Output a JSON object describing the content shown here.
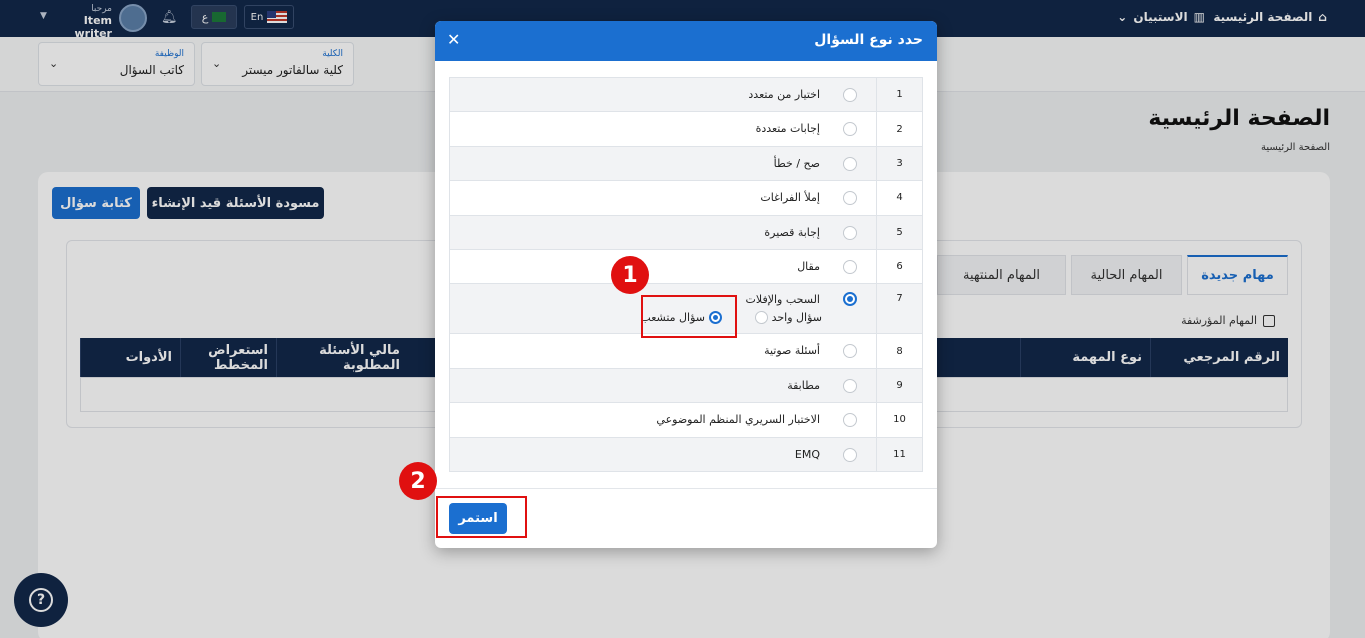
{
  "topbar": {
    "brand": "الصفحة الرئيسية",
    "school": "الاستبيان",
    "lang_en": "En",
    "lang_ar": "ع",
    "greeting": "مرحبا",
    "username": "Item writer"
  },
  "subbar": {
    "college_caption": "الكلية",
    "college_value": "كلية سالفاتور ميستر",
    "job_caption": "الوظيفة",
    "job_value": "كاتب السؤال"
  },
  "page": {
    "title": "الصفحة الرئيسية",
    "breadcrumb": "الصفحة الرئيسية",
    "write_button": "كتابة سؤال",
    "draft_button": "مسودة الأسئلة قيد الإنشاء",
    "tabs": [
      "مهام جديدة",
      "المهام الحالية",
      "المهام المنتهية"
    ],
    "archived_label": "المهام المؤرشفة",
    "columns": [
      "الرقم المرجعي",
      "نوع المهمة",
      "مالي الأسئلة المطلوبة",
      "استعراض المخطط",
      "الأدوات"
    ]
  },
  "modal": {
    "title": "حدد نوع السؤال",
    "continue_button": "استمر",
    "options": [
      {
        "num": "1",
        "label": "اختيار من متعدد"
      },
      {
        "num": "2",
        "label": "إجابات متعددة"
      },
      {
        "num": "3",
        "label": "صح / خطأ"
      },
      {
        "num": "4",
        "label": "إملأ الفراغات"
      },
      {
        "num": "5",
        "label": "إجابة قصيرة"
      },
      {
        "num": "6",
        "label": "مقال"
      },
      {
        "num": "7",
        "label": "السحب والإفلات",
        "selected": true,
        "suboptions": [
          {
            "label": "سؤال واحد",
            "selected": false
          },
          {
            "label": "سؤال متشعب",
            "selected": true
          }
        ]
      },
      {
        "num": "8",
        "label": "أسئلة صوتية"
      },
      {
        "num": "9",
        "label": "مطابقة"
      },
      {
        "num": "10",
        "label": "الاختبار السريري المنظم الموضوعي"
      },
      {
        "num": "11",
        "label": "EMQ"
      }
    ]
  },
  "annotations": {
    "marker_1": "1",
    "marker_2": "2",
    "color": "#e01010"
  },
  "colors": {
    "primary": "#1b6fd0",
    "navy": "#12284a"
  }
}
